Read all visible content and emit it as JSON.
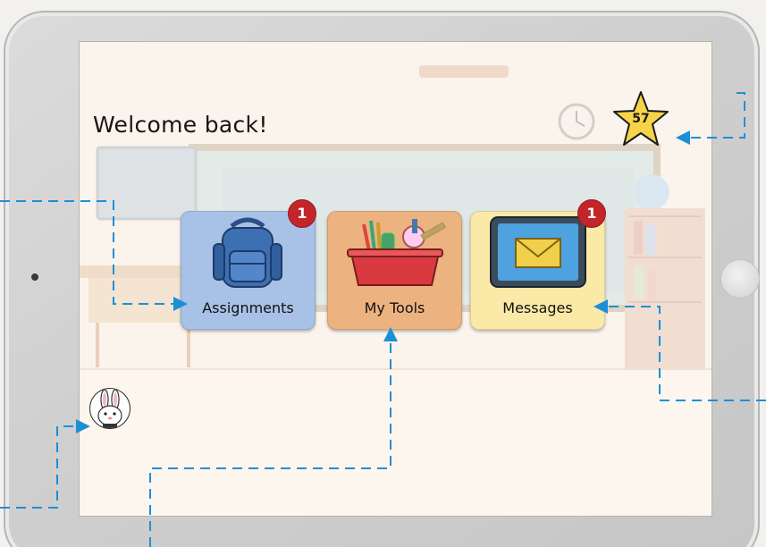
{
  "welcome_text": "Welcome back!",
  "stars": {
    "count": "57",
    "icon": "star-icon"
  },
  "tiles": [
    {
      "label": "Assignments",
      "badge": "1",
      "icon": "backpack-icon",
      "color": "#a8c1e6"
    },
    {
      "label": "My Tools",
      "badge": "",
      "icon": "toolbox-icon",
      "color": "#ecb27f"
    },
    {
      "label": "Messages",
      "badge": "1",
      "icon": "envelope-tablet-icon",
      "color": "#fbe9a8"
    }
  ],
  "avatar": {
    "icon": "bunny-avatar-icon"
  },
  "colors": {
    "callout_line": "#1d8fd6",
    "badge": "#c4252a",
    "star": "#f6d34a"
  }
}
